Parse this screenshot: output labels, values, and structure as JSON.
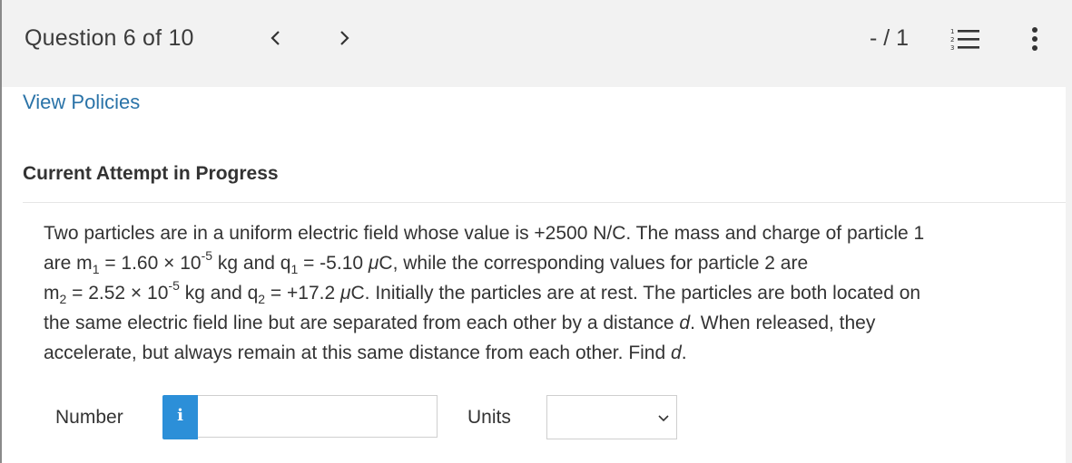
{
  "header": {
    "question_label": "Question 6 of 10",
    "score": "- / 1",
    "icons": [
      "chevron-left-icon",
      "chevron-right-icon",
      "numbered-list-icon",
      "more-vertical-icon"
    ]
  },
  "links": {
    "view_policies": "View Policies"
  },
  "section": {
    "attempt_title": "Current Attempt in Progress"
  },
  "question": {
    "l1": "Two particles are in a uniform electric field whose value is +2500 N/C. The mass and charge of particle 1",
    "l2_a": "are m",
    "l2_sub1": "1",
    "l2_b": " = 1.60 × 10",
    "l2_sup1": "-5",
    "l2_c": " kg and q",
    "l2_sub2": "1",
    "l2_d": " = -5.10 ",
    "l2_mu": "μ",
    "l2_e": "C, while the corresponding values for particle 2 are",
    "l3_a": "m",
    "l3_sub1": "2",
    "l3_b": " = 2.52 × 10",
    "l3_sup1": "-5",
    "l3_c": " kg and q",
    "l3_sub2": "2",
    "l3_d": " = +17.2 ",
    "l3_mu": "μ",
    "l3_e": "C. Initially the particles are at rest. The particles are both located on",
    "l4_a": "the same electric field line but are separated from each other by a distance ",
    "l4_var": "d",
    "l4_b": ". When released, they",
    "l5_a": "accelerate, but always remain at this same distance from each other. Find ",
    "l5_var": "d",
    "l5_b": "."
  },
  "answer": {
    "number_label": "Number",
    "info_glyph": "i",
    "number_value": "",
    "units_label": "Units",
    "units_value": ""
  },
  "colors": {
    "link": "#2a73a8",
    "info_button": "#2c8fd8",
    "background": "#f2f2f2",
    "panel": "#ffffff"
  }
}
